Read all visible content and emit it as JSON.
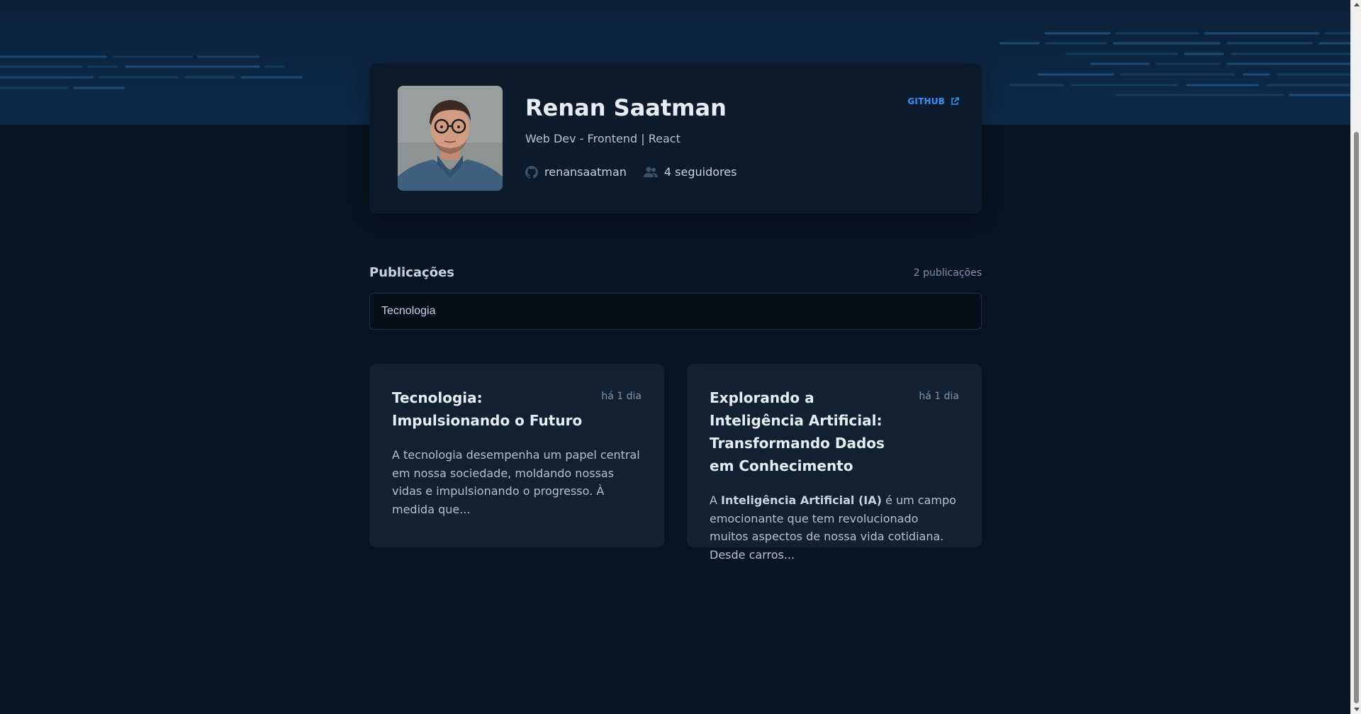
{
  "profile": {
    "name": "Renan Saatman",
    "bio": "Web Dev - Frontend | React",
    "username": "renansaatman",
    "followers": "4 seguidores",
    "github_label": "GITHUB"
  },
  "publications": {
    "title": "Publicações",
    "count": "2 publicações",
    "search_value": "Tecnologia"
  },
  "posts": [
    {
      "title": "Tecnologia: Impulsionando o Futuro",
      "date": "há 1 dia",
      "excerpt": "A tecnologia desempenha um papel central em nossa sociedade, moldando nossas vidas e impulsionando o progresso. À medida que..."
    },
    {
      "title": "Explorando a Inteligência Artificial: Transformando Dados em Conhecimento",
      "date": "há 1 dia",
      "excerpt_prefix": "A ",
      "excerpt_bold": "Inteligência Artificial (IA)",
      "excerpt_rest": " é um campo emocionante que tem revolucionado muitos aspectos de nossa vida cotidiana. Desde carros..."
    }
  ],
  "colors": {
    "background": "#071422",
    "hero": "#0e2a47",
    "card": "#0b1b2b",
    "post_card": "#112131",
    "accent": "#3294f8"
  },
  "icons": {
    "github": "github-icon",
    "followers": "users-icon",
    "external_link": "external-link-icon"
  }
}
